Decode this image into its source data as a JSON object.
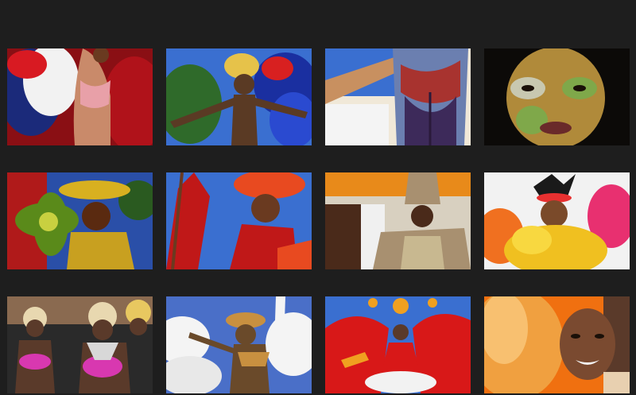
{
  "gallery": {
    "columns": 4,
    "rows": 3,
    "photos": [
      {
        "subject": "red-white-blue-feather-costume",
        "palette": [
          "#b0121a",
          "#f2f2f2",
          "#1b2a7a",
          "#c98a6a"
        ]
      },
      {
        "subject": "dancer-blue-feathers-outstretched-arms",
        "palette": [
          "#3a6fd0",
          "#2f6a2a",
          "#5a3a24",
          "#e6c24a"
        ]
      },
      {
        "subject": "body-paint-back-view",
        "palette": [
          "#6b7fb0",
          "#a8332f",
          "#3d2a5a",
          "#f0f0f0"
        ]
      },
      {
        "subject": "glitter-face-paint-portrait",
        "palette": [
          "#0c0a08",
          "#b08a3a",
          "#7fa84a",
          "#6a3a2a"
        ]
      },
      {
        "subject": "gold-headdress-green-flower",
        "palette": [
          "#2a4fa8",
          "#d8b020",
          "#5a8a1a",
          "#5a2a10"
        ]
      },
      {
        "subject": "red-winged-costume-with-staff",
        "palette": [
          "#3a6fd0",
          "#c01818",
          "#e84a20",
          "#6a3a20"
        ]
      },
      {
        "subject": "silver-beaded-king-costume-crowd",
        "palette": [
          "#d8d0c0",
          "#e88a1a",
          "#a89070",
          "#4a2a1a"
        ]
      },
      {
        "subject": "yellow-orange-feather-costume",
        "palette": [
          "#f2f2f2",
          "#f0c020",
          "#e83070",
          "#7a4a2a"
        ]
      },
      {
        "subject": "pink-beaded-dancers-group",
        "palette": [
          "#d838b0",
          "#e8d8b0",
          "#5a3a2a",
          "#2a2a2a"
        ]
      },
      {
        "subject": "white-feather-dancer-sky",
        "palette": [
          "#4a6fc8",
          "#f4f4f4",
          "#c89040",
          "#6a4a2a"
        ]
      },
      {
        "subject": "red-gold-ornate-float",
        "palette": [
          "#3a6fd0",
          "#d81818",
          "#f0a020",
          "#f2f2f2"
        ]
      },
      {
        "subject": "orange-feather-smiling-portrait",
        "palette": [
          "#f07010",
          "#f0a040",
          "#5a3a2a",
          "#e8d0b0"
        ]
      }
    ]
  }
}
